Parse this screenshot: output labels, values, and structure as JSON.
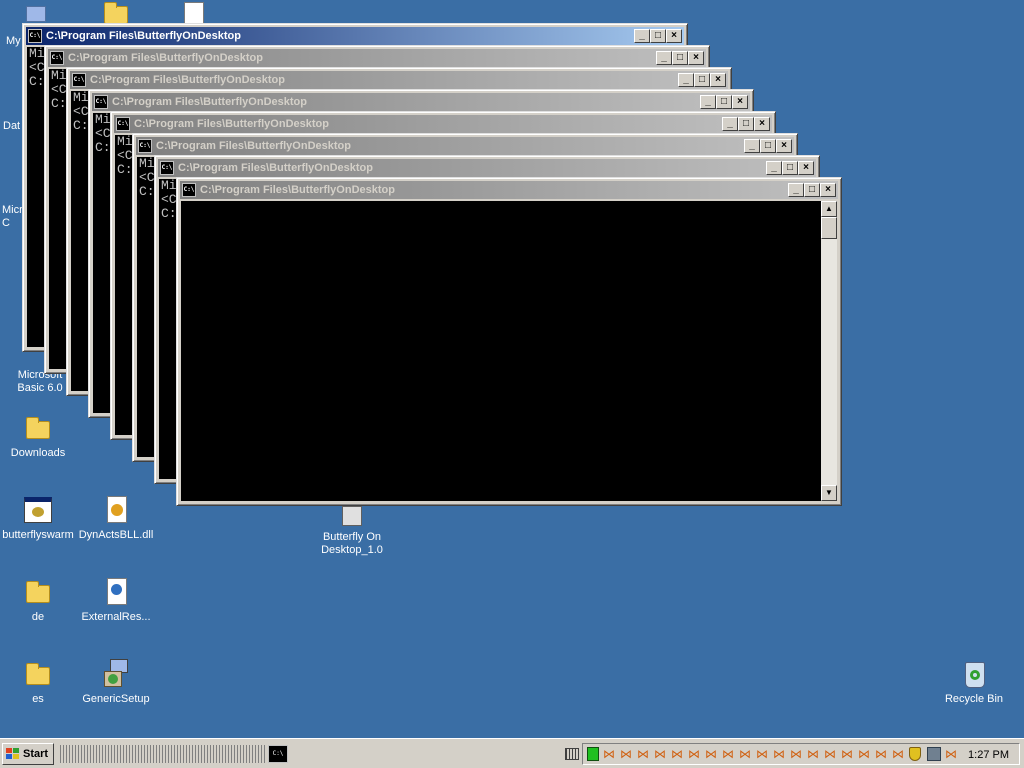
{
  "desktop": {
    "icons": [
      {
        "label": "My",
        "icon": "my-computer-icon"
      },
      {
        "label": "Dat",
        "icon": "database-icon"
      },
      {
        "label": "Micro C",
        "icon": "program-icon"
      },
      {
        "label": "Microsoft Basic 6.0",
        "icon": "vb6-icon"
      },
      {
        "label": "Downloads",
        "icon": "folder-icon"
      },
      {
        "label": "butterflyswarm",
        "icon": "app-icon"
      },
      {
        "label": "DynActsBLL.dll",
        "icon": "dll-icon"
      },
      {
        "label": "Butterfly On Desktop_1.0",
        "icon": "installer-icon"
      },
      {
        "label": "de",
        "icon": "folder-icon"
      },
      {
        "label": "ExternalRes...",
        "icon": "document-icon"
      },
      {
        "label": "es",
        "icon": "folder-icon"
      },
      {
        "label": "GenericSetup",
        "icon": "setup-icon"
      },
      {
        "label": "Recycle Bin",
        "icon": "recycle-bin-icon"
      }
    ]
  },
  "windows": [
    {
      "title": "C:\\Program Files\\ButterflyOnDesktop",
      "console_lines": [
        "Mi",
        "<C",
        "",
        "C:"
      ],
      "active": true
    },
    {
      "title": "C:\\Program Files\\ButterflyOnDesktop",
      "console_lines": [
        "Mi",
        "<C",
        "",
        "C:"
      ],
      "active": false
    },
    {
      "title": "C:\\Program Files\\ButterflyOnDesktop",
      "console_lines": [
        "Mi",
        "<C",
        "",
        "C:"
      ],
      "active": false
    },
    {
      "title": "C:\\Program Files\\ButterflyOnDesktop",
      "console_lines": [
        "Mi",
        "<C",
        "",
        "C:"
      ],
      "active": false
    },
    {
      "title": "C:\\Program Files\\ButterflyOnDesktop",
      "console_lines": [
        "Mi",
        "<C",
        "",
        "C:"
      ],
      "active": false
    },
    {
      "title": "C:\\Program Files\\ButterflyOnDesktop",
      "console_lines": [
        "Mi",
        "<C",
        "",
        "C:"
      ],
      "active": false
    },
    {
      "title": "C:\\Program Files\\ButterflyOnDesktop",
      "console_lines": [
        "Mi",
        "<C",
        "",
        "C:"
      ],
      "active": false
    },
    {
      "title": "C:\\Program Files\\ButterflyOnDesktop",
      "console_lines": [],
      "active": false
    }
  ],
  "window_controls": {
    "minimize": "_",
    "maximize": "□",
    "close": "×"
  },
  "cmd_icon_text": "C:\\",
  "taskbar": {
    "start_label": "Start",
    "task_button_icon": "C:\\",
    "tray_butterfly_count": 18,
    "clock": "1:27 PM"
  },
  "colors": {
    "desktop": "#3a6ea5",
    "active_title": "#0a246a",
    "inactive_title": "#808080",
    "butterfly": "#d06010"
  }
}
